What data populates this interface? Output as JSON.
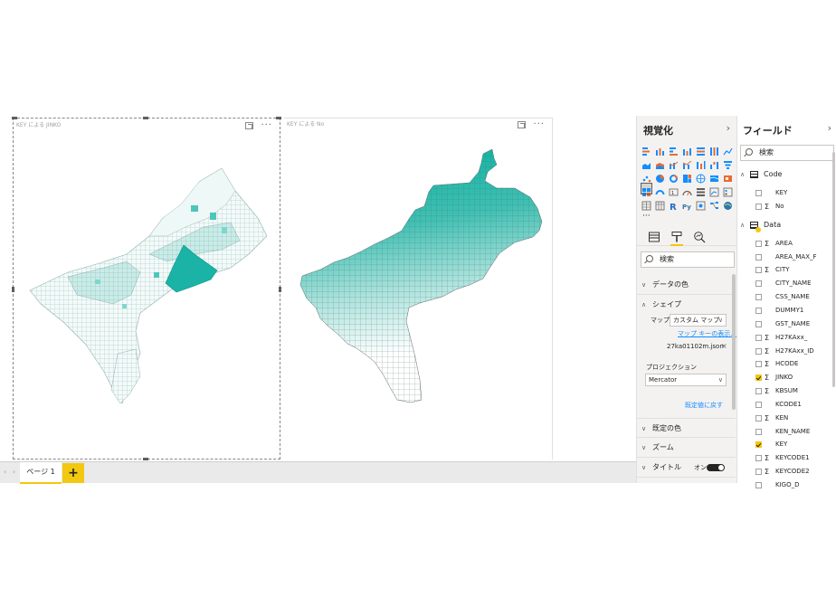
{
  "canvas": {
    "visual1": {
      "title": "KEY による JINKO"
    },
    "visual2": {
      "title": "KEY による No"
    }
  },
  "page_tabs": {
    "tabs": [
      "ページ 1"
    ],
    "add_label": "+"
  },
  "visualizations_pane": {
    "title": "視覚化",
    "search_placeholder": "検索",
    "more_label": "···",
    "sections": {
      "data_colors": "データの色",
      "shape": "シェイプ",
      "default_colors": "既定の色",
      "zoom": "ズーム",
      "title": "タイトル"
    },
    "shape_settings": {
      "map_label": "マップ",
      "map_value": "カスタム マップ",
      "map_keys_link": "マップ キーの表示...",
      "file_name": "27ka01102m.json",
      "projection_label": "プロジェクション",
      "projection_value": "Mercator",
      "reset_link": "既定値に戻す"
    },
    "title_toggle_label": "オン"
  },
  "fields_pane": {
    "title": "フィールド",
    "search_placeholder": "検索",
    "tables": [
      {
        "name": "Code",
        "fields": [
          {
            "name": "KEY",
            "sigma": false,
            "checked": false
          },
          {
            "name": "No",
            "sigma": true,
            "checked": false
          }
        ]
      },
      {
        "name": "Data",
        "fields": [
          {
            "name": "AREA",
            "sigma": true,
            "checked": false
          },
          {
            "name": "AREA_MAX_F",
            "sigma": false,
            "checked": false
          },
          {
            "name": "CITY",
            "sigma": true,
            "checked": false
          },
          {
            "name": "CITY_NAME",
            "sigma": false,
            "checked": false
          },
          {
            "name": "CSS_NAME",
            "sigma": false,
            "checked": false
          },
          {
            "name": "DUMMY1",
            "sigma": false,
            "checked": false
          },
          {
            "name": "GST_NAME",
            "sigma": false,
            "checked": false
          },
          {
            "name": "H27KAxx_",
            "sigma": true,
            "checked": false
          },
          {
            "name": "H27KAxx_ID",
            "sigma": true,
            "checked": false
          },
          {
            "name": "HCODE",
            "sigma": true,
            "checked": false
          },
          {
            "name": "JINKO",
            "sigma": true,
            "checked": true
          },
          {
            "name": "KBSUM",
            "sigma": true,
            "checked": false
          },
          {
            "name": "KCODE1",
            "sigma": false,
            "checked": false
          },
          {
            "name": "KEN",
            "sigma": true,
            "checked": false
          },
          {
            "name": "KEN_NAME",
            "sigma": false,
            "checked": false
          },
          {
            "name": "KEY",
            "sigma": false,
            "checked": true
          },
          {
            "name": "KEYCODE1",
            "sigma": true,
            "checked": false
          },
          {
            "name": "KEYCODE2",
            "sigma": true,
            "checked": false
          },
          {
            "name": "KIGO_D",
            "sigma": false,
            "checked": false
          }
        ]
      }
    ]
  },
  "colors": {
    "accent": "#f2c811",
    "map_teal": "#1ab3a6",
    "map_light": "#e6f6f4",
    "link": "#118dff"
  }
}
